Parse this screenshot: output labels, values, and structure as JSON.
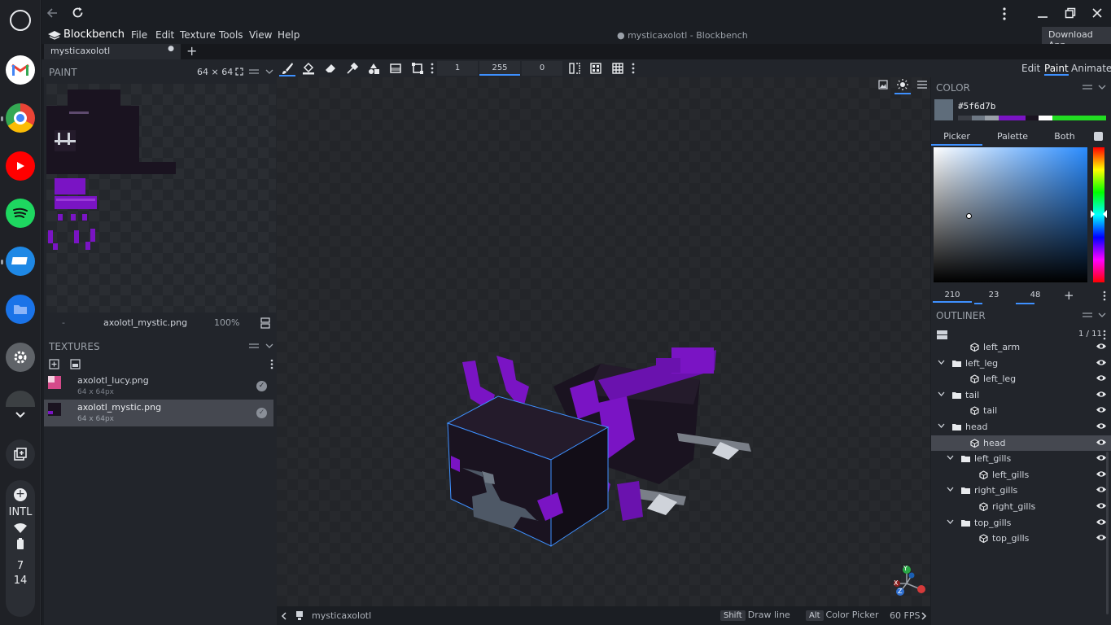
{
  "shelf": {
    "apps": [
      "launcher-icon",
      "gmail-icon",
      "chrome-icon",
      "youtube-icon",
      "spotify-icon",
      "tv-app-icon",
      "files-icon",
      "settings-icon",
      "app-partial-icon"
    ],
    "tray": {
      "input": "INTL",
      "time_h": "7",
      "time_m": "14"
    }
  },
  "window": {
    "download_label": "Download App",
    "title": "● mysticaxolotl - Blockbench"
  },
  "menu": {
    "brand": "Blockbench",
    "items": [
      "File",
      "Edit",
      "Texture",
      "Tools",
      "View",
      "Help"
    ]
  },
  "tab": {
    "name": "mysticaxolotl",
    "dot": "●",
    "add": "+"
  },
  "toolbar": {
    "brush_size": "1",
    "opacity": "255",
    "softness": "0"
  },
  "modes": [
    "Edit",
    "Paint",
    "Animate"
  ],
  "paint": {
    "header": "PAINT",
    "size": "64 ⨯ 64",
    "dash": "-",
    "texture_name": "axolotl_mystic.png",
    "zoom": "100%"
  },
  "textures": {
    "header": "TEXTURES",
    "items": [
      {
        "name": "axolotl_lucy.png",
        "size": "64 x 64px"
      },
      {
        "name": "axolotl_mystic.png",
        "size": "64 x 64px"
      }
    ]
  },
  "color": {
    "header": "COLOR",
    "hex": "#5f6d7b",
    "tabs": [
      "Picker",
      "Palette",
      "Both"
    ],
    "h": "210",
    "s": "23",
    "v": "48",
    "swatch": "#5f6d7b"
  },
  "outliner": {
    "header": "OUTLINER",
    "count": "1 / 11",
    "rows": [
      {
        "label": "left_arm",
        "type": "cube"
      },
      {
        "label": "left_leg",
        "type": "group"
      },
      {
        "label": "left_leg",
        "type": "cube"
      },
      {
        "label": "tail",
        "type": "group"
      },
      {
        "label": "tail",
        "type": "cube"
      },
      {
        "label": "head",
        "type": "group"
      },
      {
        "label": "head",
        "type": "cube",
        "selected": true
      },
      {
        "label": "left_gills",
        "type": "group"
      },
      {
        "label": "left_gills",
        "type": "cube"
      },
      {
        "label": "right_gills",
        "type": "group"
      },
      {
        "label": "right_gills",
        "type": "cube"
      },
      {
        "label": "top_gills",
        "type": "group"
      },
      {
        "label": "top_gills",
        "type": "cube"
      }
    ]
  },
  "status": {
    "model": "mysticaxolotl",
    "shift_key": "Shift",
    "shift_action": "Draw line",
    "alt_key": "Alt",
    "alt_action": "Color Picker",
    "fps": "60 FPS"
  },
  "gizmo": {
    "x": "X",
    "y": "Y",
    "z": "Z"
  },
  "colors": {
    "accent": "#3e90ff",
    "purple": "#7a14c4",
    "dark": "#1a1320"
  }
}
